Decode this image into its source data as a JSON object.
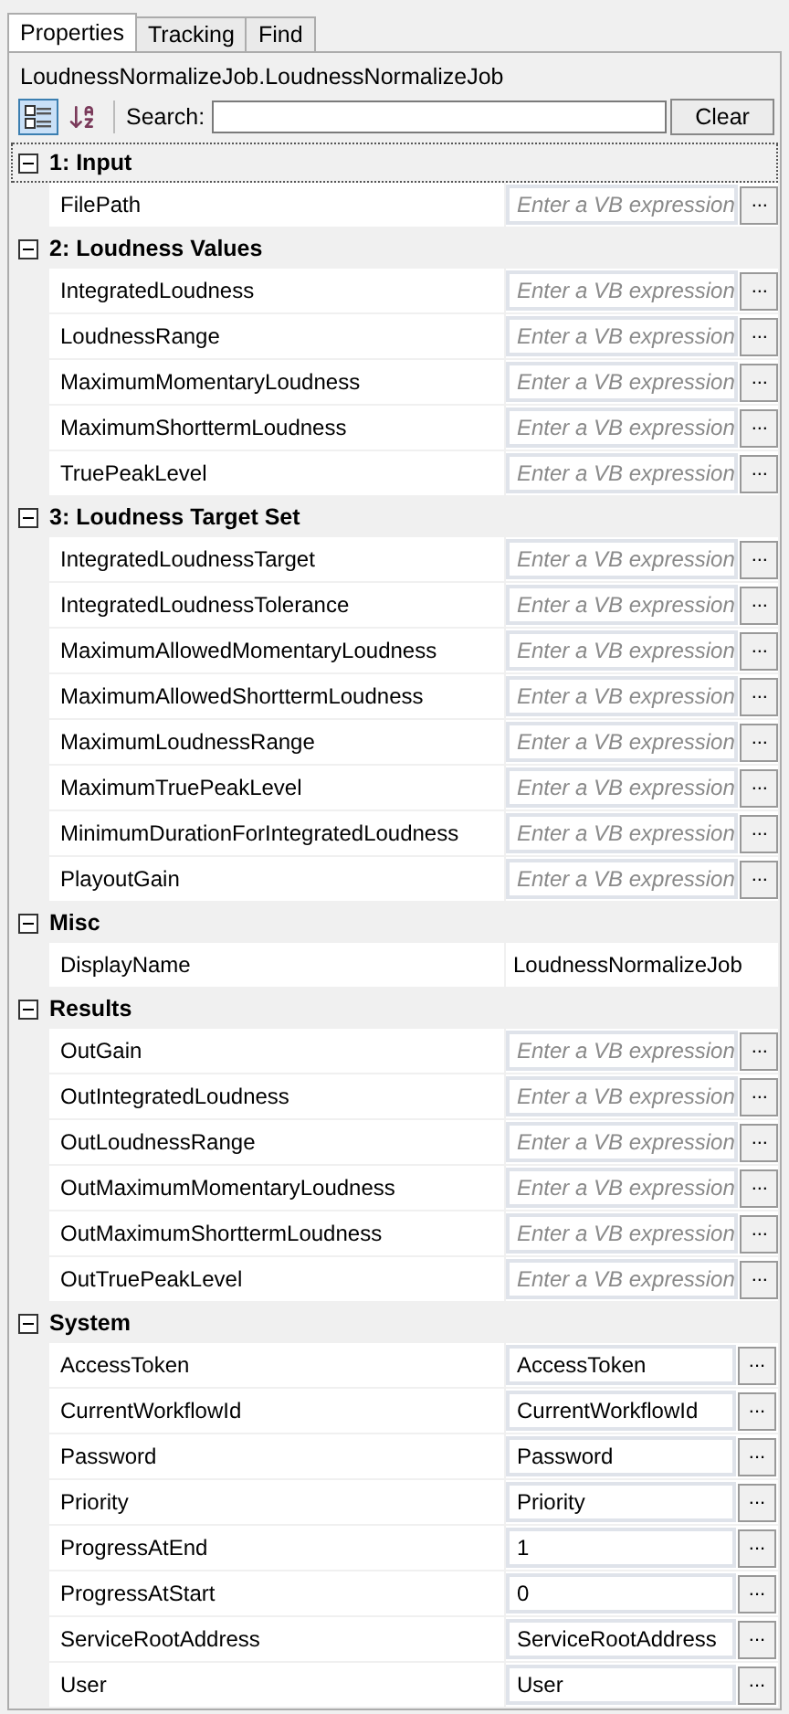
{
  "tabs": [
    {
      "label": "Properties",
      "selected": true
    },
    {
      "label": "Tracking",
      "selected": false
    },
    {
      "label": "Find",
      "selected": false
    }
  ],
  "object_title": "LoudnessNormalizeJob.LoudnessNormalizeJob",
  "toolbar": {
    "view_buttons": [
      {
        "kind": "categorized",
        "selected": true
      },
      {
        "kind": "alphabetical",
        "selected": false
      }
    ],
    "search_label": "Search:",
    "clear_button": "Clear"
  },
  "categories": [
    {
      "name": "1: Input",
      "expanded": true,
      "focused": true,
      "properties": [
        {
          "name": "FilePath",
          "kind": "expression",
          "placeholder": "Enter a VB expression",
          "button": "..."
        }
      ]
    },
    {
      "name": "2: Loudness Values",
      "expanded": true,
      "focused": false,
      "properties": [
        {
          "name": "IntegratedLoudness",
          "kind": "expression",
          "placeholder": "Enter a VB expression",
          "button": "..."
        },
        {
          "name": "LoudnessRange",
          "kind": "expression",
          "placeholder": "Enter a VB expression",
          "button": "..."
        },
        {
          "name": "MaximumMomentaryLoudness",
          "kind": "expression",
          "placeholder": "Enter a VB expression",
          "button": "..."
        },
        {
          "name": "MaximumShorttermLoudness",
          "kind": "expression",
          "placeholder": "Enter a VB expression",
          "button": "..."
        },
        {
          "name": "TruePeakLevel",
          "kind": "expression",
          "placeholder": "Enter a VB expression",
          "button": "..."
        }
      ]
    },
    {
      "name": "3: Loudness Target Set",
      "expanded": true,
      "focused": false,
      "properties": [
        {
          "name": "IntegratedLoudnessTarget",
          "kind": "expression",
          "placeholder": "Enter a VB expression",
          "button": "..."
        },
        {
          "name": "IntegratedLoudnessTolerance",
          "kind": "expression",
          "placeholder": "Enter a VB expression",
          "button": "..."
        },
        {
          "name": "MaximumAllowedMomentaryLoudness",
          "kind": "expression",
          "placeholder": "Enter a VB expression",
          "button": "..."
        },
        {
          "name": "MaximumAllowedShorttermLoudness",
          "kind": "expression",
          "placeholder": "Enter a VB expression",
          "button": "..."
        },
        {
          "name": "MaximumLoudnessRange",
          "kind": "expression",
          "placeholder": "Enter a VB expression",
          "button": "..."
        },
        {
          "name": "MaximumTruePeakLevel",
          "kind": "expression",
          "placeholder": "Enter a VB expression",
          "button": "..."
        },
        {
          "name": "MinimumDurationForIntegratedLoudness",
          "kind": "expression",
          "placeholder": "Enter a VB expression",
          "button": "..."
        },
        {
          "name": "PlayoutGain",
          "kind": "expression",
          "placeholder": "Enter a VB expression",
          "button": "..."
        }
      ]
    },
    {
      "name": "Misc",
      "expanded": true,
      "focused": false,
      "properties": [
        {
          "name": "DisplayName",
          "kind": "text",
          "value": "LoudnessNormalizeJob"
        }
      ]
    },
    {
      "name": "Results",
      "expanded": true,
      "focused": false,
      "properties": [
        {
          "name": "OutGain",
          "kind": "expression",
          "placeholder": "Enter a VB expression",
          "button": "..."
        },
        {
          "name": "OutIntegratedLoudness",
          "kind": "expression",
          "placeholder": "Enter a VB expression",
          "button": "..."
        },
        {
          "name": "OutLoudnessRange",
          "kind": "expression",
          "placeholder": "Enter a VB expression",
          "button": "..."
        },
        {
          "name": "OutMaximumMomentaryLoudness",
          "kind": "expression",
          "placeholder": "Enter a VB expression",
          "button": "..."
        },
        {
          "name": "OutMaximumShorttermLoudness",
          "kind": "expression",
          "placeholder": "Enter a VB expression",
          "button": "..."
        },
        {
          "name": "OutTruePeakLevel",
          "kind": "expression",
          "placeholder": "Enter a VB expression",
          "button": "..."
        }
      ]
    },
    {
      "name": "System",
      "expanded": true,
      "focused": false,
      "properties": [
        {
          "name": "AccessToken",
          "kind": "expression",
          "value": "AccessToken",
          "button": "..."
        },
        {
          "name": "CurrentWorkflowId",
          "kind": "expression",
          "value": "CurrentWorkflowId",
          "button": "..."
        },
        {
          "name": "Password",
          "kind": "expression",
          "value": "Password",
          "button": "..."
        },
        {
          "name": "Priority",
          "kind": "expression",
          "value": "Priority",
          "button": "..."
        },
        {
          "name": "ProgressAtEnd",
          "kind": "expression",
          "value": "1",
          "button": "..."
        },
        {
          "name": "ProgressAtStart",
          "kind": "expression",
          "value": "0",
          "button": "..."
        },
        {
          "name": "ServiceRootAddress",
          "kind": "expression",
          "value": "ServiceRootAddress",
          "button": "..."
        },
        {
          "name": "User",
          "kind": "expression",
          "value": "User",
          "button": "..."
        }
      ]
    }
  ]
}
